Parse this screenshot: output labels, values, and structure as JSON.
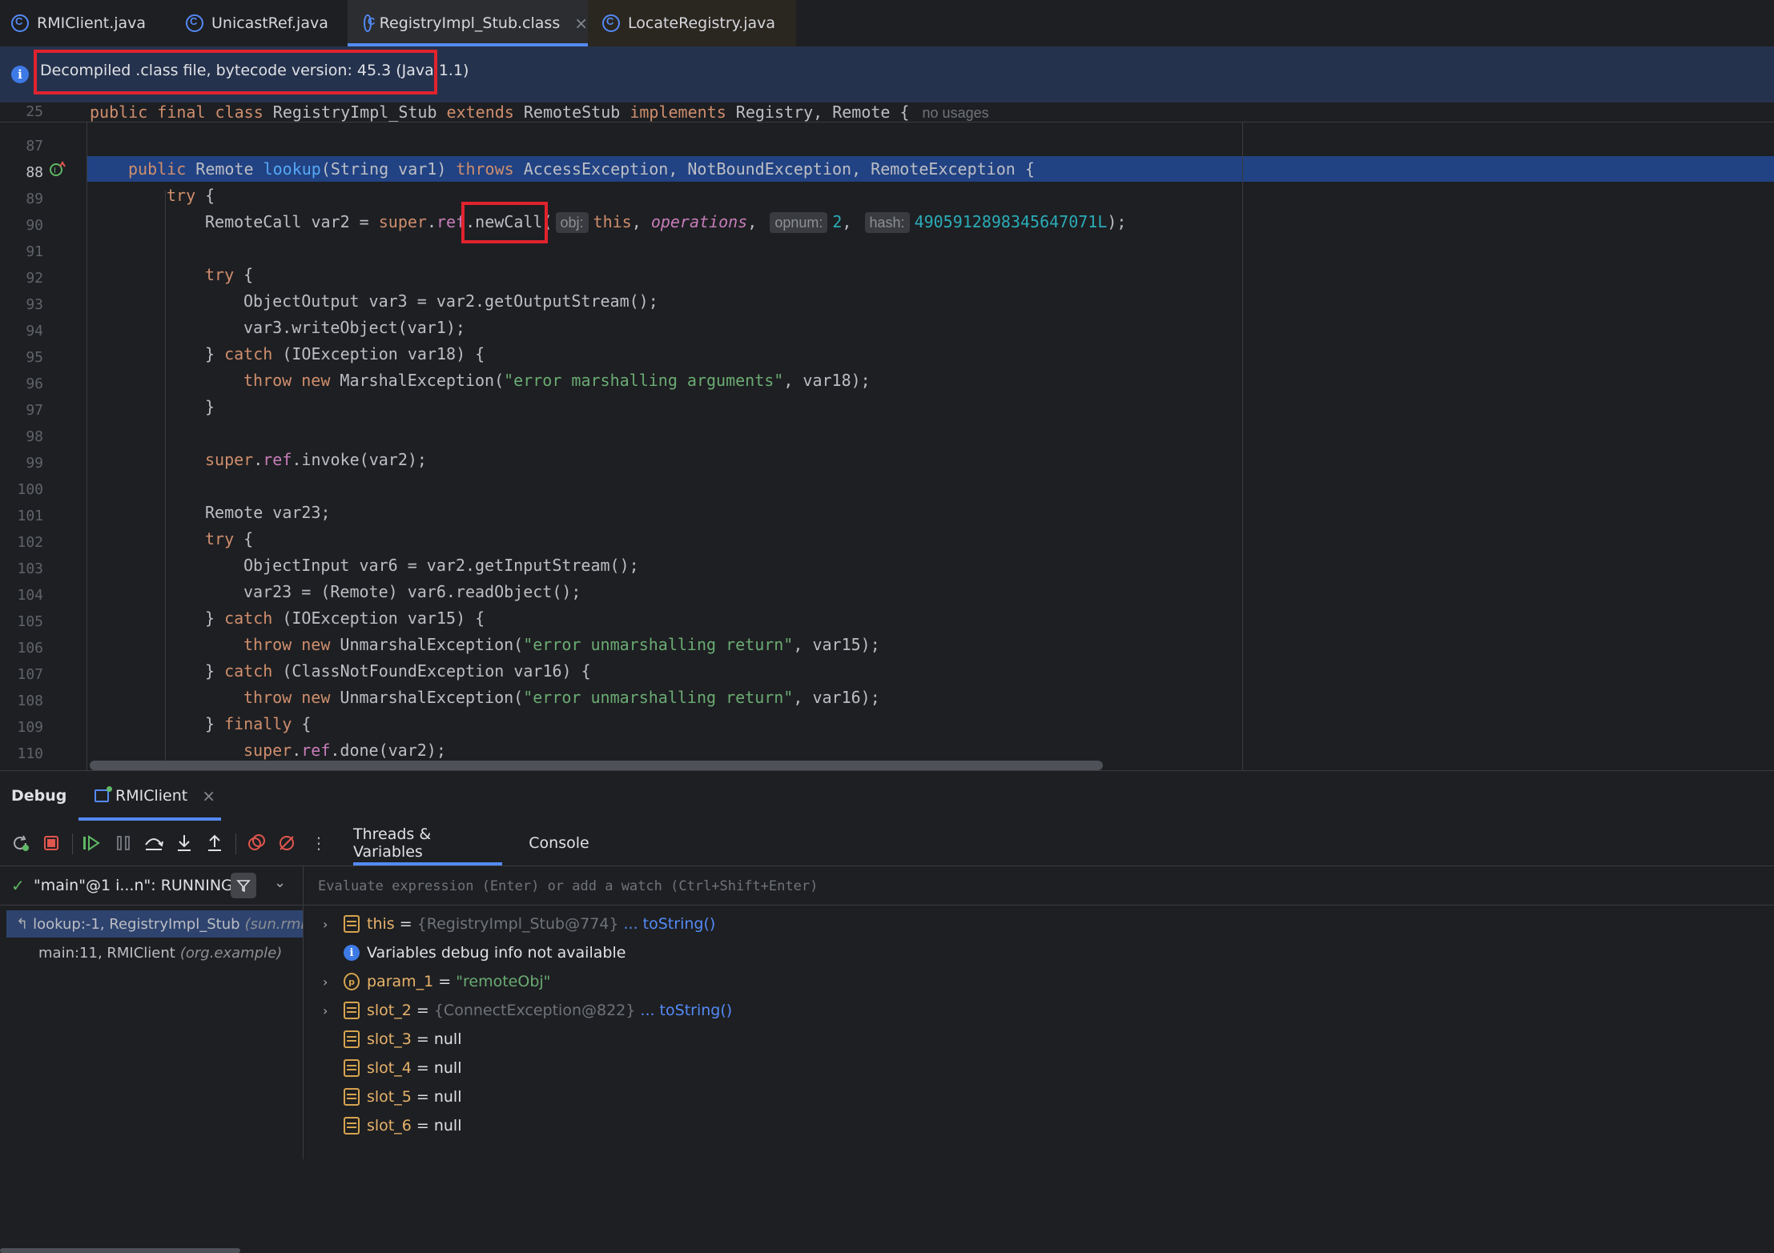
{
  "tabs": [
    {
      "label": "RMIClient.java",
      "icon": "class-icon",
      "active": false
    },
    {
      "label": "UnicastRef.java",
      "icon": "class-icon",
      "active": false
    },
    {
      "label": "RegistryImpl_Stub.class",
      "icon": "compiled-class-icon",
      "active": true,
      "close": "×"
    },
    {
      "label": "LocateRegistry.java",
      "icon": "compiled-class-icon",
      "active": false
    }
  ],
  "banner": {
    "icon": "info-icon",
    "text": "Decompiled .class file, bytecode version: 45.3 (Java 1.1)"
  },
  "editor": {
    "sticky": {
      "line": "25",
      "kw1": "public final class",
      "cls": " RegistryImpl_Stub ",
      "kw2": "extends",
      "mid": " RemoteStub ",
      "kw3": "implements",
      "tail": " Registry, Remote {",
      "usages": "no usages"
    },
    "line_numbers": [
      "87",
      "88",
      "89",
      "90",
      "91",
      "92",
      "93",
      "94",
      "95",
      "96",
      "97",
      "98",
      "99",
      "100",
      "101",
      "102",
      "103",
      "104",
      "105",
      "106",
      "107",
      "108",
      "109",
      "110"
    ],
    "current_line": "88",
    "hints": {
      "obj": "obj:",
      "opnum": "opnum:",
      "hash": "hash:"
    },
    "colors": {
      "keyword": "#cf8e6d",
      "method": "#56a8f5",
      "field": "#c77dbb",
      "string": "#6aab73",
      "number": "#2aacb8",
      "highlight": "#214283"
    }
  },
  "debug": {
    "title": "Debug",
    "session": "RMIClient",
    "session_close": "×",
    "subtabs": [
      "Threads & Variables",
      "Console"
    ],
    "thread": "\"main\"@1 i...n\": RUNNING",
    "frames": [
      {
        "method": "lookup:-1, RegistryImpl_Stub",
        "pkg": "(sun.rmi.",
        "selected": true
      },
      {
        "method": "main:11, RMIClient",
        "pkg": "(org.example)",
        "selected": false
      }
    ],
    "watch_placeholder": "Evaluate expression (Enter) or add a watch (Ctrl+Shift+Enter)",
    "variables": [
      {
        "name": "this",
        "eq": " = ",
        "value": "{RegistryImpl_Stub@774}",
        "link": " ... toString()",
        "kind": "field",
        "expandable": true
      },
      {
        "info": "Variables debug info not available",
        "kind": "info"
      },
      {
        "name": "param_1",
        "eq": " = ",
        "value": "\"remoteObj\"",
        "kind": "param",
        "expandable": true
      },
      {
        "name": "slot_2",
        "eq": " = ",
        "value": "{ConnectException@822}",
        "link": " ... toString()",
        "kind": "field",
        "expandable": true
      },
      {
        "name": "slot_3",
        "eq": " = ",
        "value": "null",
        "kind": "field"
      },
      {
        "name": "slot_4",
        "eq": " = ",
        "value": "null",
        "kind": "field"
      },
      {
        "name": "slot_5",
        "eq": " = ",
        "value": "null",
        "kind": "field"
      },
      {
        "name": "slot_6",
        "eq": " = ",
        "value": "null",
        "kind": "field"
      }
    ]
  },
  "accent": "#548af7",
  "annotation_color": "#e0232e"
}
